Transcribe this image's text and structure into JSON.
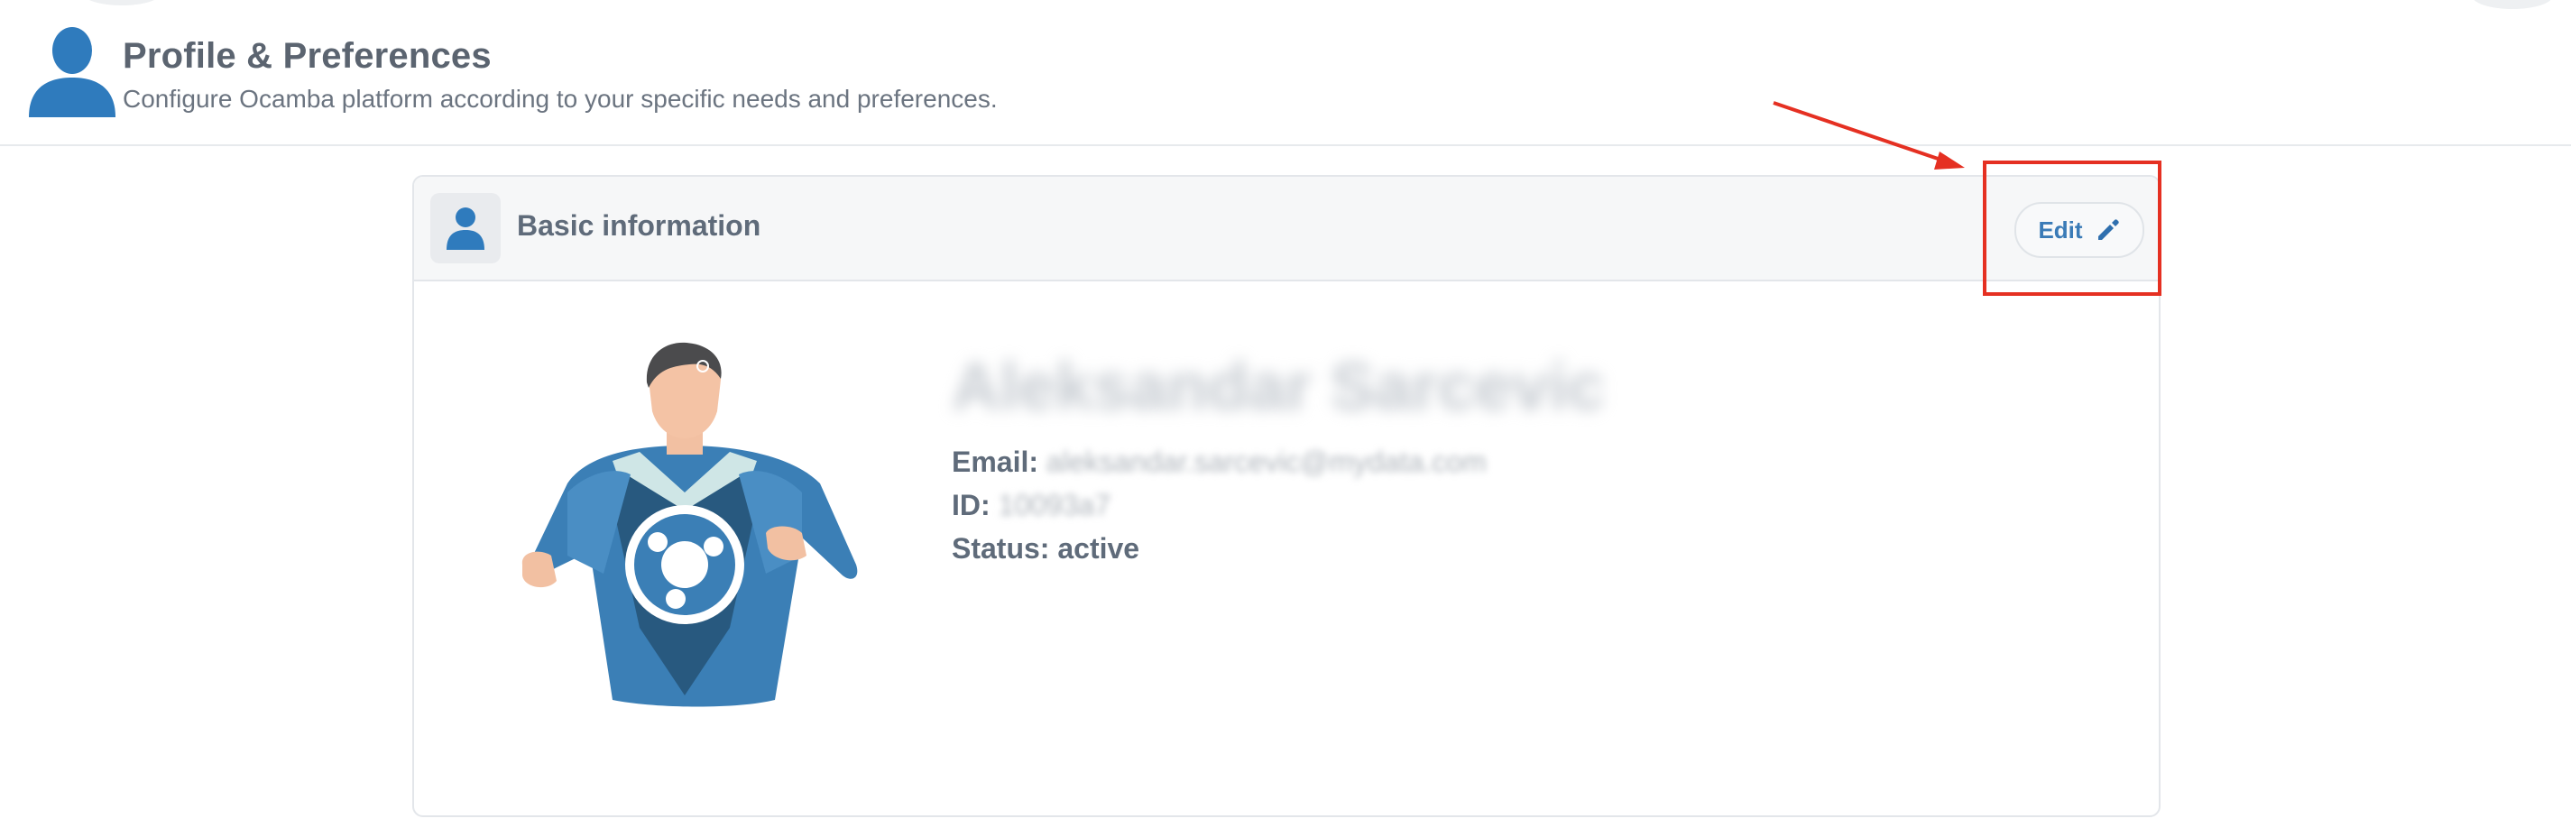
{
  "header": {
    "title": "Profile & Preferences",
    "subtitle": "Configure Ocamba platform according to your specific needs and preferences.",
    "icon": "user-icon"
  },
  "card": {
    "title": "Basic information",
    "header_icon": "user-icon",
    "edit_label": "Edit",
    "edit_icon": "pencil-icon",
    "accent_color": "#3a7bb7"
  },
  "profile": {
    "name": "Aleksandar Sarcevic",
    "email_label": "Email:",
    "email_value": "aleksandar.sarcevic@mydata.com",
    "id_label": "ID:",
    "id_value": "10093a7",
    "status_label": "Status:",
    "status_value": "active",
    "avatar": "superhero-avatar"
  },
  "annotation": {
    "color": "#e53022"
  }
}
